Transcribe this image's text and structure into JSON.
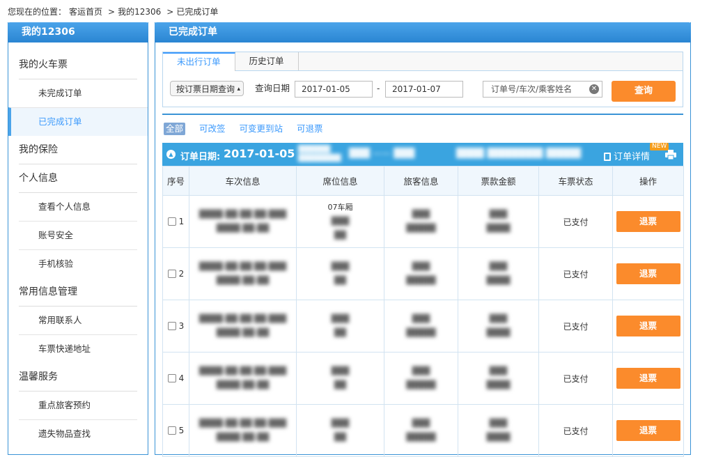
{
  "breadcrumb": {
    "prefix": "您现在的位置：",
    "items": [
      "客运首页",
      "我的12306",
      "已完成订单"
    ],
    "separator": ">"
  },
  "sidebar": {
    "title": "我的12306",
    "groups": [
      {
        "label": "我的火车票",
        "items": [
          "未完成订单",
          "已完成订单"
        ]
      },
      {
        "label": "我的保险",
        "items": []
      },
      {
        "label": "个人信息",
        "items": [
          "查看个人信息",
          "账号安全",
          "手机核验"
        ]
      },
      {
        "label": "常用信息管理",
        "items": [
          "常用联系人",
          "车票快递地址"
        ]
      },
      {
        "label": "温馨服务",
        "items": [
          "重点旅客预约",
          "遗失物品查找"
        ]
      }
    ],
    "active_item": "已完成订单"
  },
  "main": {
    "title": "已完成订单",
    "tabs": [
      "未出行订单",
      "历史订单"
    ],
    "active_tab": "未出行订单",
    "query_type": "按订票日期查询",
    "query_date_label": "查询日期",
    "date_from": "2017-01-05",
    "date_sep": "-",
    "date_to": "2017-01-07",
    "keyword_placeholder": "订单号/车次/乘客姓名",
    "search_button": "查询",
    "filters": [
      "全部",
      "可改签",
      "可变更到站",
      "可退票"
    ],
    "active_filter": "全部"
  },
  "order": {
    "date_label": "订单日期:",
    "date": "2017-01-05",
    "detail_label": "订单详情",
    "new_badge": "NEW",
    "columns": [
      "序号",
      "车次信息",
      "席位信息",
      "旅客信息",
      "票款金额",
      "车票状态",
      "操作"
    ],
    "rows": [
      {
        "no": "1",
        "seat_car": "07车厢",
        "status": "已支付",
        "action": "退票"
      },
      {
        "no": "2",
        "seat_car": "",
        "status": "已支付",
        "action": "退票"
      },
      {
        "no": "3",
        "seat_car": "",
        "status": "已支付",
        "action": "退票"
      },
      {
        "no": "4",
        "seat_car": "",
        "status": "已支付",
        "action": "退票"
      },
      {
        "no": "5",
        "seat_car": "",
        "status": "已支付",
        "action": "退票"
      }
    ]
  },
  "colors": {
    "accent": "#3b99fc",
    "header_blue": "#3aa4e0",
    "button_orange": "#fb8b2c"
  }
}
